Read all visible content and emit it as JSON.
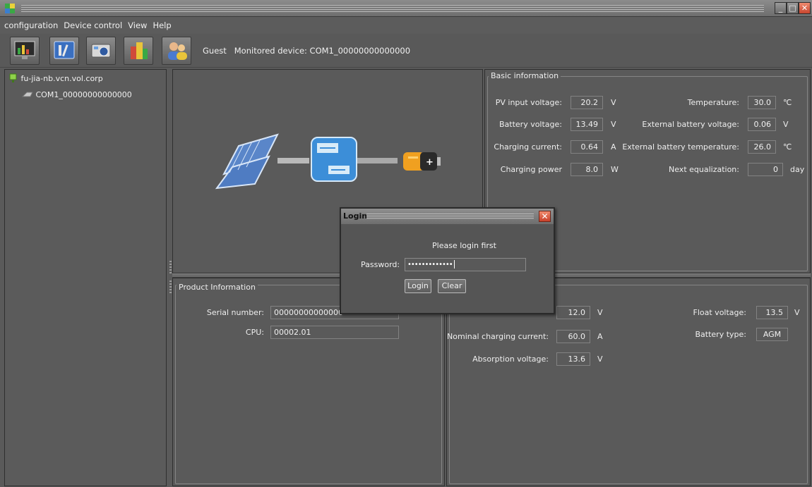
{
  "window": {
    "minimize": "_",
    "maximize": "□",
    "close": "✕"
  },
  "menu": [
    "configuration",
    "Device control",
    "View",
    "Help"
  ],
  "toolbar": {
    "icons": [
      "monitor-icon",
      "settings-tools-icon",
      "camera-icon",
      "buildings-icon",
      "users-icon"
    ],
    "user": "Guest",
    "monitored_label": "Monitored device:",
    "monitored_value": "COM1_00000000000000"
  },
  "tree": {
    "root": "fu-jia-nb.vcn.vol.corp",
    "child": "COM1_00000000000000"
  },
  "basic_info": {
    "title": "Basic information",
    "left": [
      {
        "label": "PV input voltage:",
        "value": "20.2",
        "unit": "V"
      },
      {
        "label": "Battery voltage:",
        "value": "13.49",
        "unit": "V"
      },
      {
        "label": "Charging current:",
        "value": "0.64",
        "unit": "A"
      },
      {
        "label": "Charging power",
        "value": "8.0",
        "unit": "W"
      }
    ],
    "right": [
      {
        "label": "Temperature:",
        "value": "30.0",
        "unit": "℃"
      },
      {
        "label": "External battery voltage:",
        "value": "0.06",
        "unit": "V"
      },
      {
        "label": "External battery temperature:",
        "value": "26.0",
        "unit": "℃"
      },
      {
        "label": "Next equalization:",
        "value": "0",
        "unit": "day"
      }
    ]
  },
  "product_info": {
    "title": "Product Information",
    "serial_label": "Serial number:",
    "serial_value": "00000000000000",
    "cpu_label": "CPU:",
    "cpu_value": "00002.01"
  },
  "battery_settings": {
    "left": [
      {
        "label": "",
        "value": "12.0",
        "unit": "V"
      },
      {
        "label": "Nominal charging current:",
        "value": "60.0",
        "unit": "A"
      },
      {
        "label": "Absorption voltage:",
        "value": "13.6",
        "unit": "V"
      }
    ],
    "right": [
      {
        "label": "Float voltage:",
        "value": "13.5",
        "unit": "V"
      },
      {
        "label": "Battery type:",
        "value": "AGM",
        "unit": ""
      }
    ]
  },
  "login": {
    "title": "Login",
    "close": "✕",
    "message": "Please login first",
    "password_label": "Password:",
    "password_value": "•••••••••••••",
    "login_button": "Login",
    "clear_button": "Clear"
  }
}
